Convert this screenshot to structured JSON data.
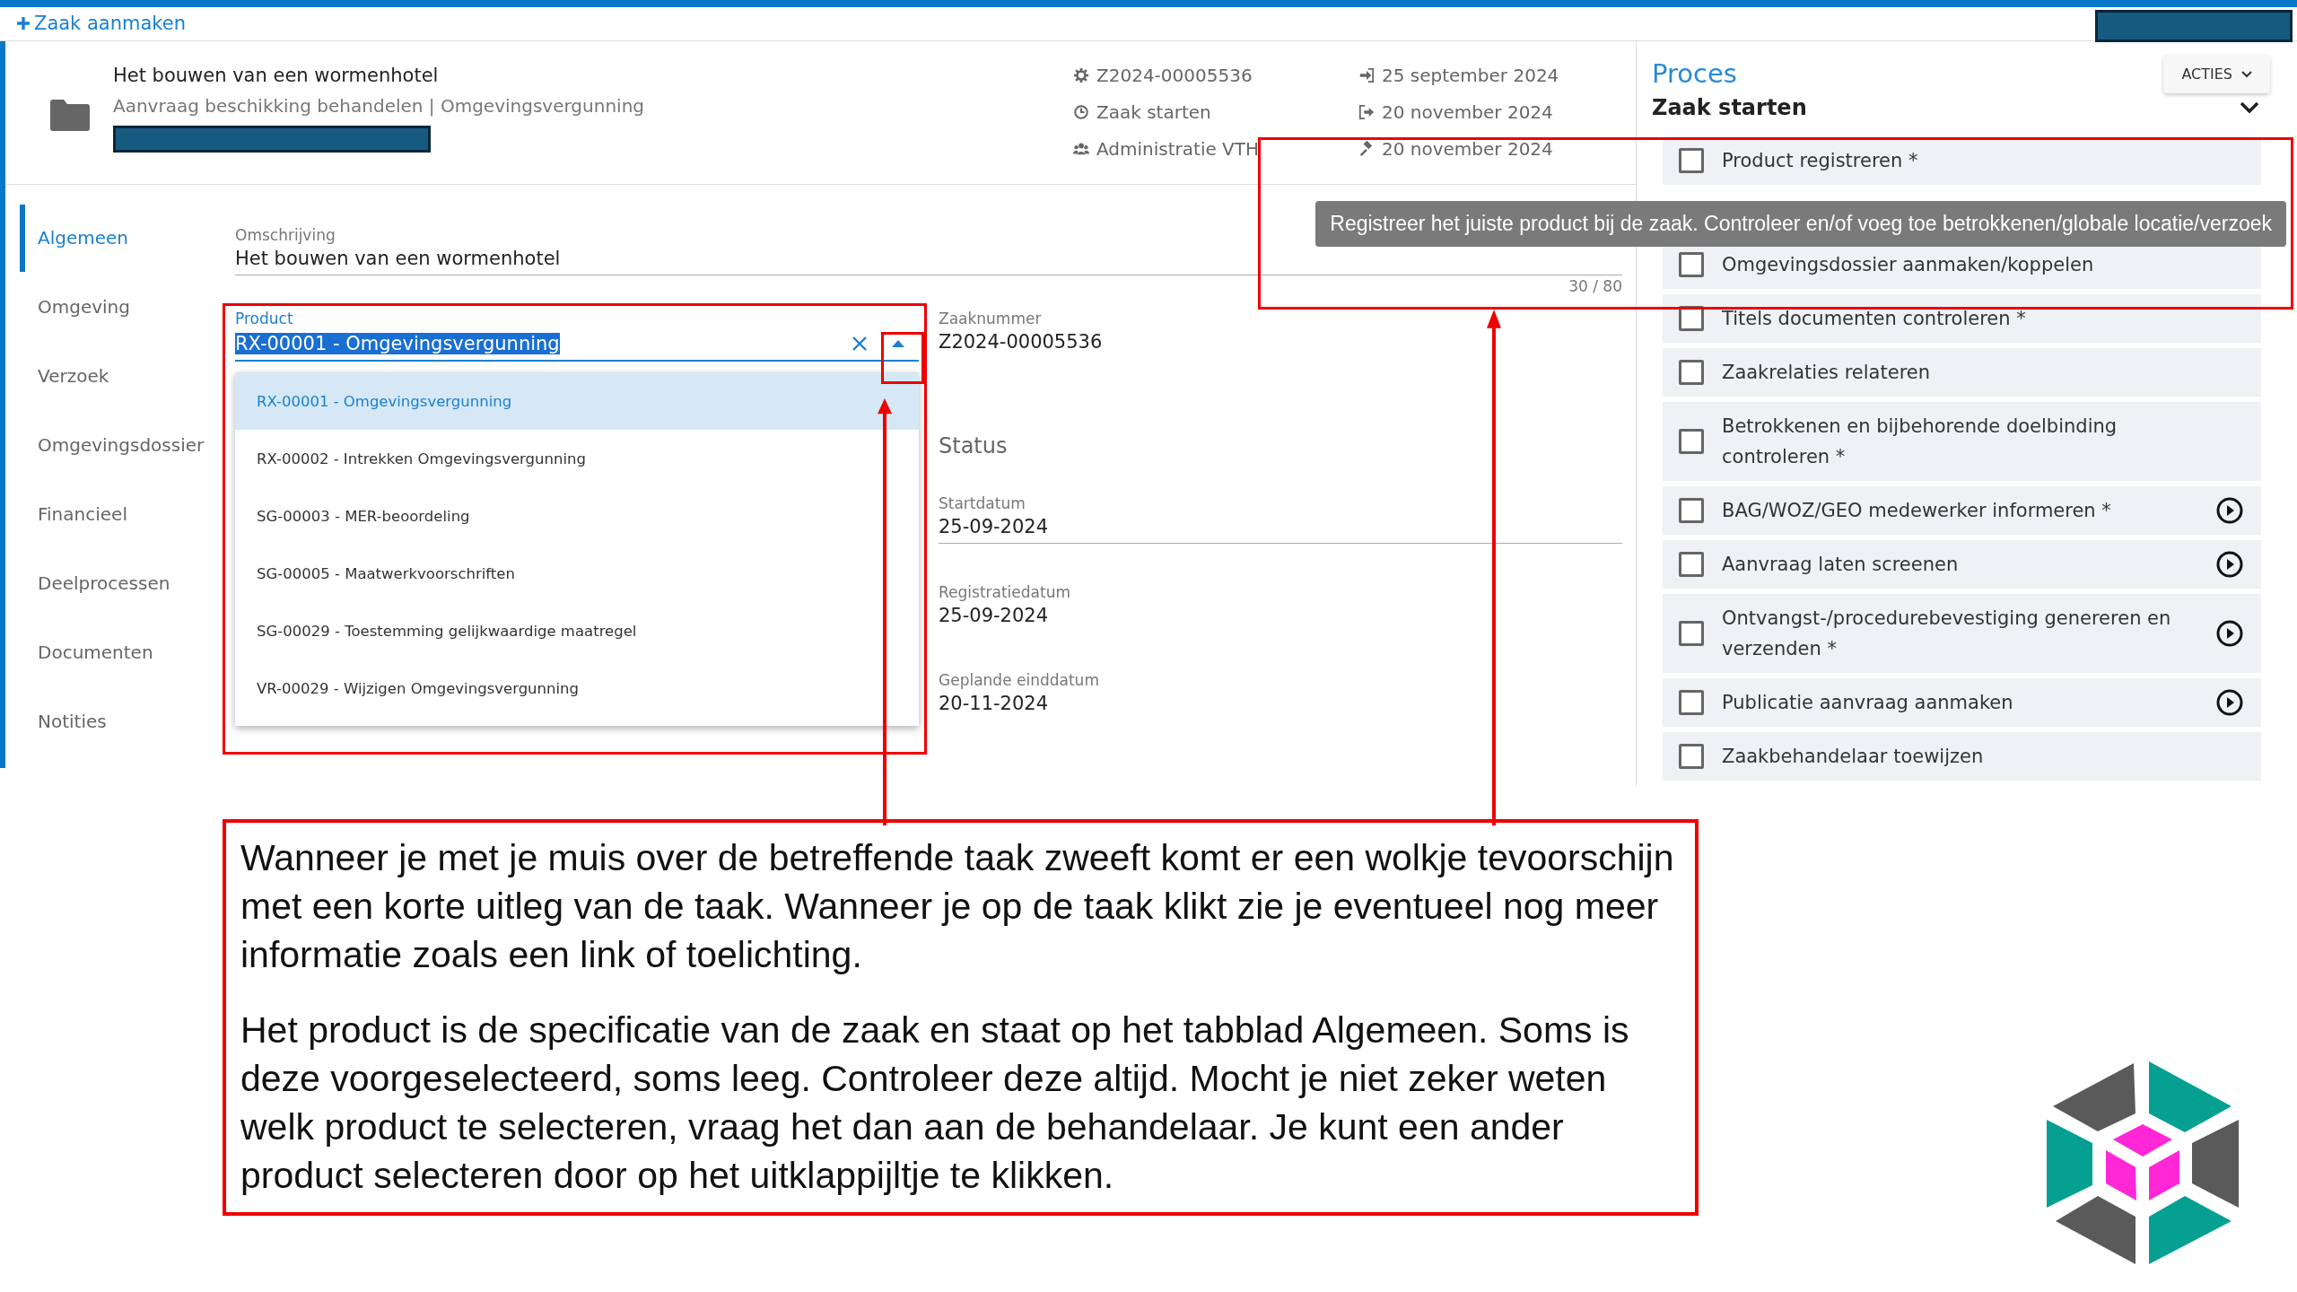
{
  "top_bar": {
    "create_link": "Zaak aanmaken"
  },
  "case_header": {
    "title": "Het bouwen van een wormenhotel",
    "subtitle": "Aanvraag beschikking behandelen | Omgevingsvergunning",
    "meta": [
      {
        "kind": "case-number",
        "text": "Z2024-00005536"
      },
      {
        "kind": "phase",
        "text": "Zaak starten"
      },
      {
        "kind": "department",
        "text": "Administratie VTH"
      }
    ],
    "dates": [
      {
        "kind": "received",
        "text": "25 september 2024"
      },
      {
        "kind": "deadline",
        "text": "20 november 2024"
      },
      {
        "kind": "decision",
        "text": "20 november 2024"
      }
    ]
  },
  "nav": [
    {
      "label": "Algemeen",
      "selected": true
    },
    {
      "label": "Omgeving",
      "selected": false
    },
    {
      "label": "Verzoek",
      "selected": false
    },
    {
      "label": "Omgevingsdossier",
      "selected": false
    },
    {
      "label": "Financieel",
      "selected": false
    },
    {
      "label": "Deelprocessen",
      "selected": false
    },
    {
      "label": "Documenten",
      "selected": false
    },
    {
      "label": "Notities",
      "selected": false
    }
  ],
  "form": {
    "description": {
      "label": "Omschrijving",
      "value": "Het bouwen van een wormenhotel",
      "counter": "30 / 80"
    },
    "product": {
      "label": "Product",
      "value": "RX-00001 - Omgevingsvergunning",
      "highlighted": true,
      "options": [
        {
          "label": "RX-00001 - Omgevingsvergunning",
          "selected": true
        },
        {
          "label": "RX-00002 - Intrekken Omgevingsvergunning",
          "selected": false
        },
        {
          "label": "SG-00003 - MER-beoordeling",
          "selected": false
        },
        {
          "label": "SG-00005 - Maatwerkvoorschriften",
          "selected": false
        },
        {
          "label": "SG-00029 - Toestemming gelijkwaardige maatregel",
          "selected": false
        },
        {
          "label": "VR-00029 - Wijzigen Omgevingsvergunning",
          "selected": false
        }
      ]
    },
    "case_number": {
      "label": "Zaaknummer",
      "value": "Z2024-00005536"
    },
    "status_heading": "Status",
    "dates": [
      {
        "label": "Startdatum",
        "value": "25-09-2024",
        "underlined": true
      },
      {
        "label": "Registratiedatum",
        "value": "25-09-2024",
        "underlined": false
      },
      {
        "label": "Geplande einddatum",
        "value": "20-11-2024",
        "underlined": false
      }
    ]
  },
  "process": {
    "title": "Proces",
    "actions_button": "ACTIES",
    "phase": "Zaak starten",
    "tooltip": "Registreer het juiste product bij de zaak. Controleer en/of voeg toe betrokkenen/globale locatie/verzoek",
    "tasks": [
      {
        "label": "Product registreren *",
        "checked": false,
        "has_action": false
      },
      {
        "label": "Omgevingsdossier aanmaken/koppelen",
        "checked": false,
        "has_action": false
      },
      {
        "label": "Titels documenten controleren *",
        "checked": false,
        "has_action": false
      },
      {
        "label": "Zaakrelaties relateren",
        "checked": false,
        "has_action": false
      },
      {
        "label": "Betrokkenen en bijbehorende doelbinding controleren *",
        "checked": false,
        "has_action": false
      },
      {
        "label": "BAG/WOZ/GEO medewerker informeren *",
        "checked": false,
        "has_action": true
      },
      {
        "label": "Aanvraag laten screenen",
        "checked": false,
        "has_action": true
      },
      {
        "label": "Ontvangst-/procedurebevestiging genereren en verzenden *",
        "checked": false,
        "has_action": true
      },
      {
        "label": "Publicatie aanvraag aanmaken",
        "checked": false,
        "has_action": true
      },
      {
        "label": "Zaakbehandelaar toewijzen",
        "checked": false,
        "has_action": false
      }
    ]
  },
  "annotation": {
    "paragraphs": [
      "Wanneer je met je muis over de betreffende taak zweeft komt er een wolkje tevoorschijn met een korte uitleg van de taak. Wanneer je op de taak klikt zie je eventueel nog meer informatie zoals een link of toelichting.",
      "Het product is de specificatie van de zaak en staat op het tabblad Algemeen. Soms is deze voorgeselecteerd, soms leeg. Controleer deze altijd. Mocht je niet zeker weten welk product te selecteren, vraag het dan aan de behandelaar. Je kunt een ander product selecteren door op het uitklappijltje te klikken."
    ]
  }
}
